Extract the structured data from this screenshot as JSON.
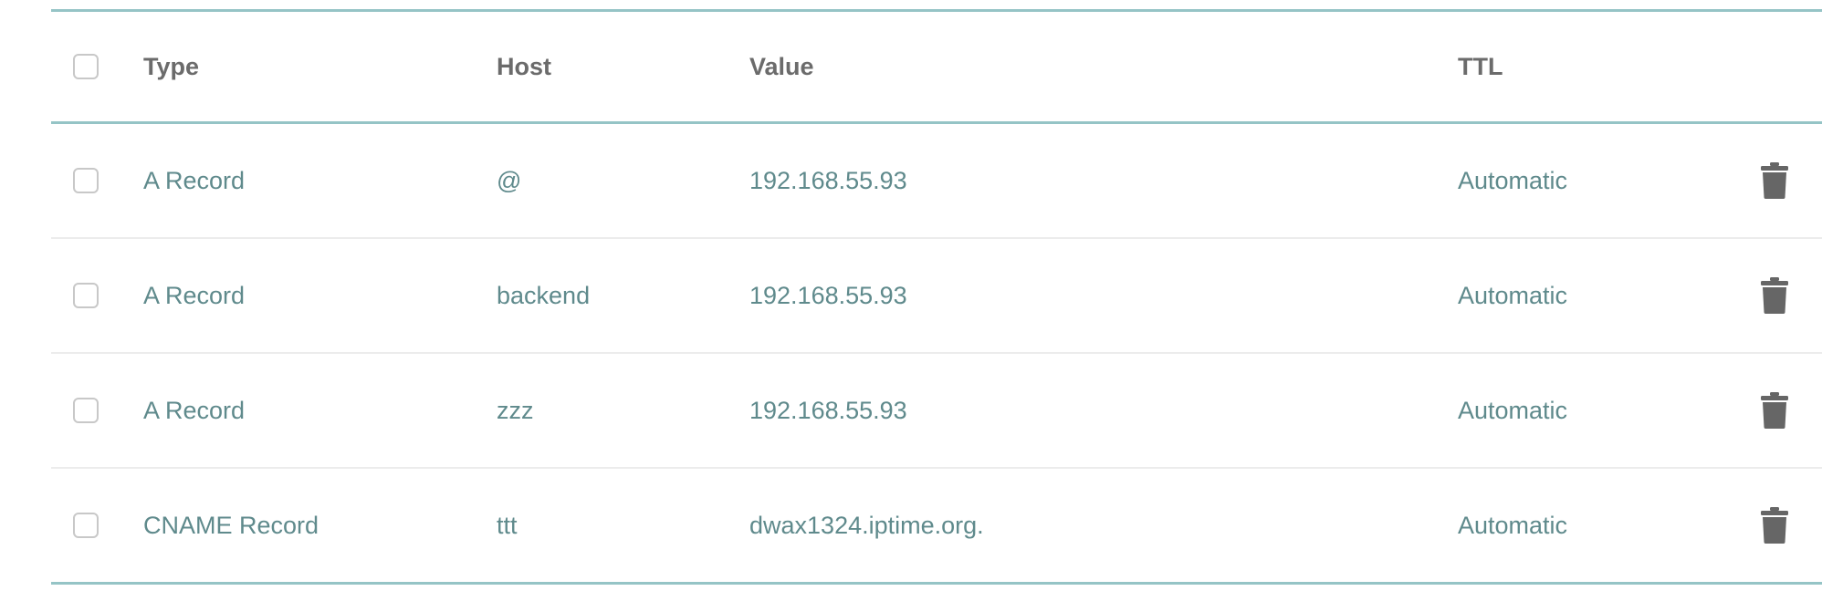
{
  "table": {
    "headers": {
      "type": "Type",
      "host": "Host",
      "value": "Value",
      "ttl": "TTL"
    },
    "rows": [
      {
        "type": "A Record",
        "host": "@",
        "value": "192.168.55.93",
        "ttl": "Automatic",
        "action_icon": "trash-icon"
      },
      {
        "type": "A Record",
        "host": "backend",
        "value": "192.168.55.93",
        "ttl": "Automatic",
        "action_icon": "trash-icon"
      },
      {
        "type": "A Record",
        "host": "zzz",
        "value": "192.168.55.93",
        "ttl": "Automatic",
        "action_icon": "trash-icon"
      },
      {
        "type": "CNAME Record",
        "host": "ttt",
        "value": "dwax1324.iptime.org.",
        "ttl": "Automatic",
        "action_icon": "trash-icon"
      }
    ]
  },
  "colors": {
    "accent_border": "#95c4c6",
    "row_divider": "#ececec",
    "header_text": "#6b6b6b",
    "cell_text": "#5f8a8c",
    "icon": "#666666",
    "checkbox_border": "#c8c8c8"
  }
}
